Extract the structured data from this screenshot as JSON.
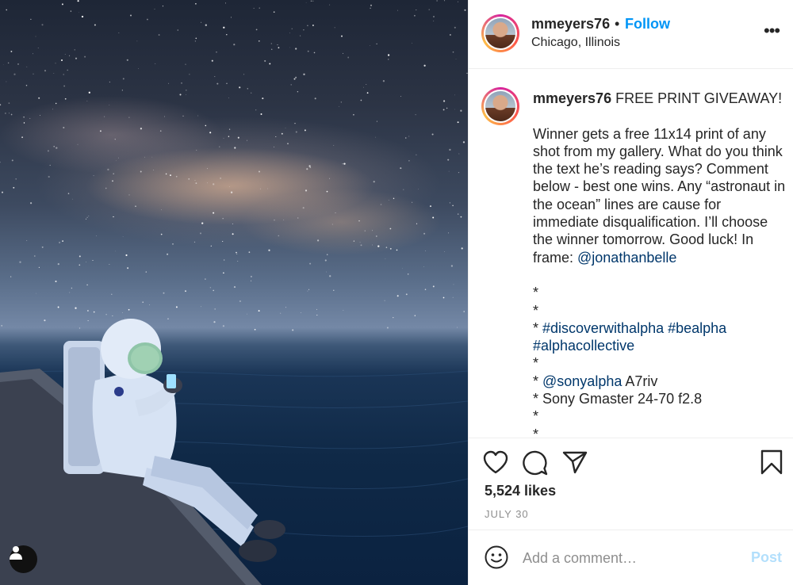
{
  "post": {
    "username": "mmeyers76",
    "separator": "•",
    "follow_label": "Follow",
    "location": "Chicago, Illinois",
    "more_label": "•••"
  },
  "caption": {
    "username": "mmeyers76",
    "headline": " FREE PRINT GIVEAWAY!",
    "body": "Winner gets a free 11x14 print of any shot from my gallery. What do you think the text he’s reading says? Comment below - best one wins. Any “astronaut in the ocean” lines are cause for immediate disqualification. I’ll choose the winner tomorrow. Good luck! In frame: ",
    "frame_tag": "@jonathanbelle",
    "star": "*",
    "star_prefix": "* ",
    "hashtags": "#discoverwithalpha #bealpha #alphacollective",
    "camera_tag": "@sonyalpha",
    "camera_model": " A7riv",
    "lens": "* Sony Gmaster 24-70 f2.8"
  },
  "stats": {
    "likes": "5,524 likes",
    "date": "JULY 30"
  },
  "comment_box": {
    "placeholder": "Add a comment…",
    "post_label": "Post"
  },
  "icons": {
    "like": "heart-icon",
    "comment": "comment-icon",
    "share": "paper-plane-icon",
    "save": "bookmark-icon",
    "emoji": "smiley-icon",
    "user_tag": "person-icon"
  },
  "colors": {
    "link": "#00376b",
    "follow": "#0095f6",
    "post_disabled": "#b2dffc",
    "muted": "#8e8e8e"
  }
}
